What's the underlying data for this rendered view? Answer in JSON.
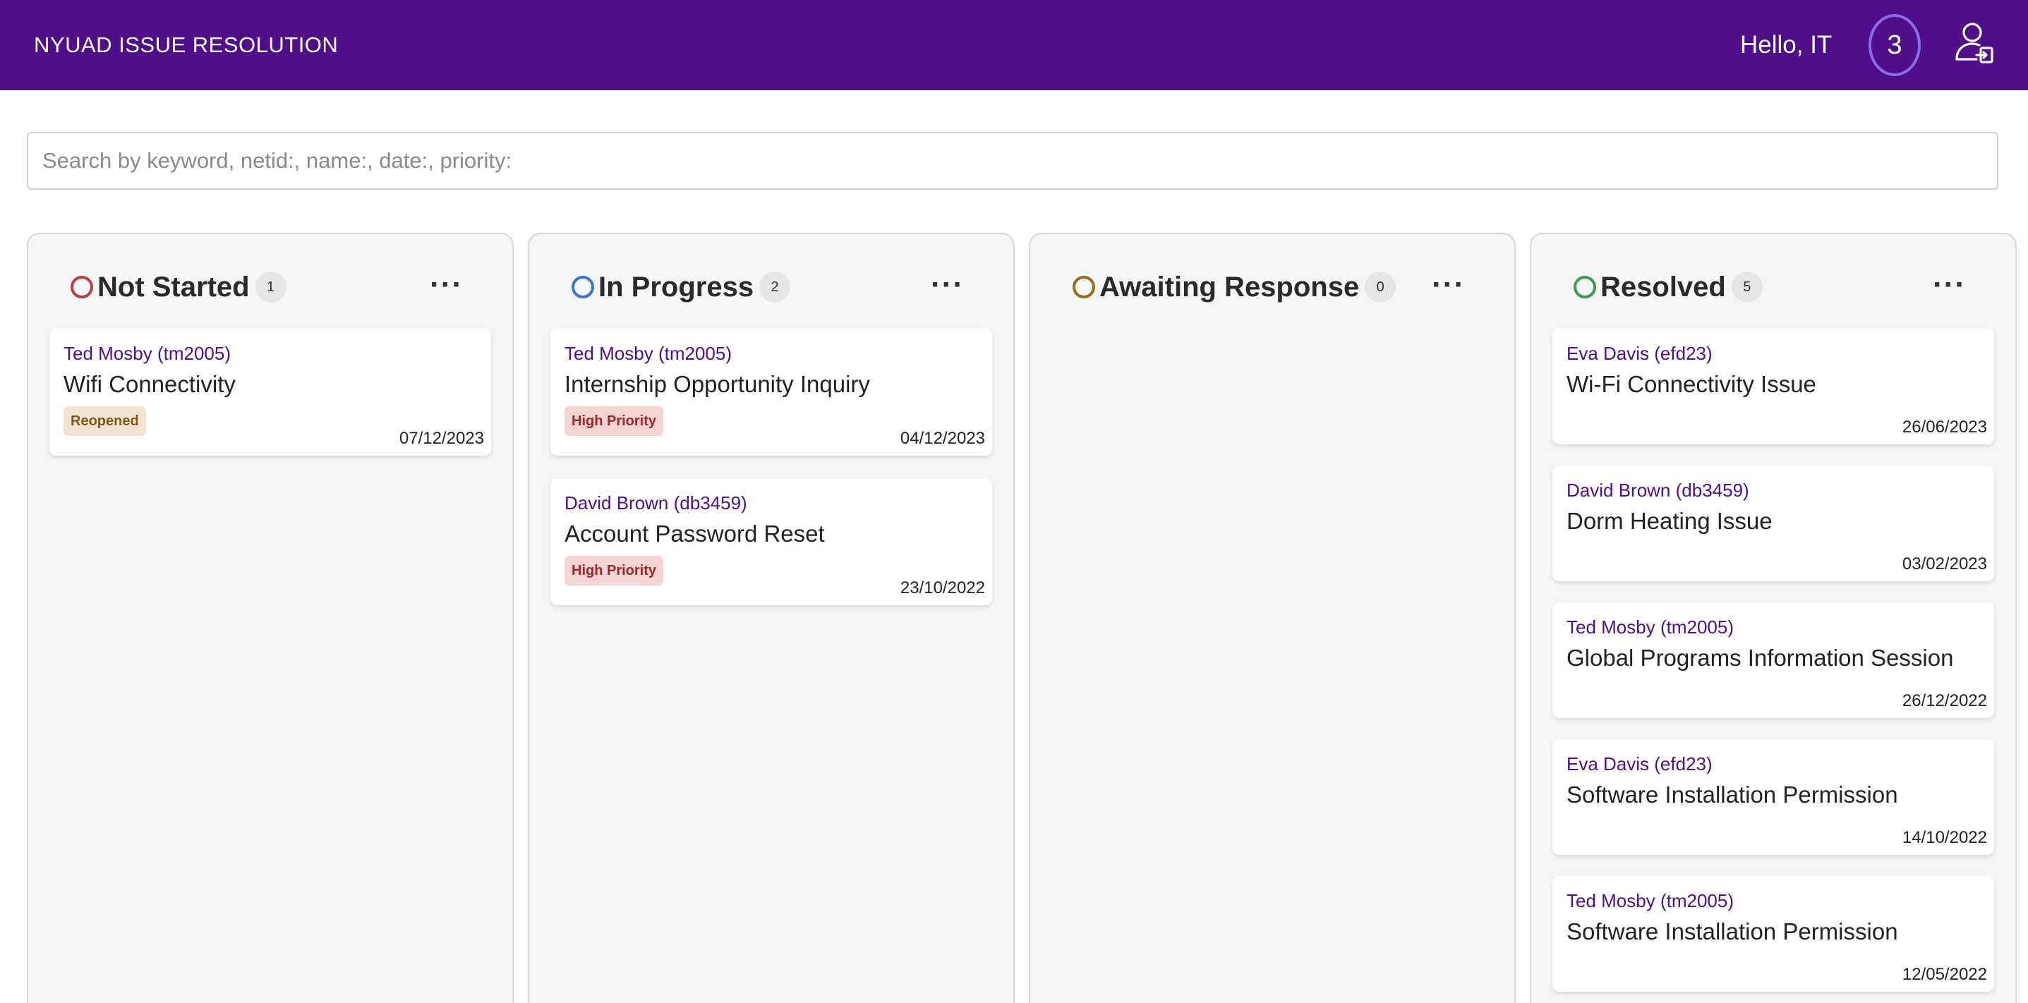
{
  "header": {
    "brand": "NYUAD ISSUE RESOLUTION",
    "greeting": "Hello, IT",
    "notification_count": "3",
    "user_icon": "user-logout-icon"
  },
  "search": {
    "placeholder": "Search by keyword, netid:, name:, date:, priority:",
    "value": ""
  },
  "columns": [
    {
      "title": "Not Started",
      "count": "1",
      "status_color": "#b5423d",
      "cards": [
        {
          "author": "Ted Mosby (tm2005)",
          "title": "Wifi Connectivity",
          "tag": "Reopened",
          "date": "07/12/2023"
        }
      ]
    },
    {
      "title": "In Progress",
      "count": "2",
      "status_color": "#3a73d9",
      "cards": [
        {
          "author": "Ted Mosby (tm2005)",
          "title": "Internship Opportunity Inquiry",
          "tag": "High Priority",
          "date": "04/12/2023"
        },
        {
          "author": "David Brown (db3459)",
          "title": "Account Password Reset",
          "tag": "High Priority",
          "date": "23/10/2022"
        }
      ]
    },
    {
      "title": "Awaiting Response",
      "count": "0",
      "status_color": "#9a6b1b",
      "cards": []
    },
    {
      "title": "Resolved",
      "count": "5",
      "status_color": "#3c9a4e",
      "cards": [
        {
          "author": "Eva Davis (efd23)",
          "title": "Wi-Fi Connectivity Issue",
          "date": "26/06/2023"
        },
        {
          "author": "David Brown (db3459)",
          "title": "Dorm Heating Issue",
          "date": "03/02/2023"
        },
        {
          "author": "Ted Mosby (tm2005)",
          "title": "Global Programs Information Session",
          "date": "26/12/2022"
        },
        {
          "author": "Eva Davis (efd23)",
          "title": "Software Installation Permission",
          "date": "14/10/2022"
        },
        {
          "author": "Ted Mosby (tm2005)",
          "title": "Software Installation Permission",
          "date": "12/05/2022"
        }
      ]
    }
  ],
  "menu_icon": "more-horizontal-icon"
}
